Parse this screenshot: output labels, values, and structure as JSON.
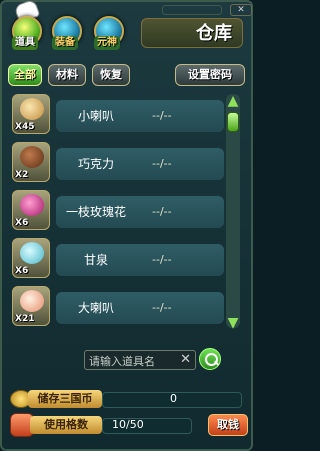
{
  "window": {
    "title": "仓库",
    "close_label": "✕"
  },
  "categories": [
    {
      "label": "道具",
      "icon": "hand-pointer-icon"
    },
    {
      "label": "装备",
      "icon": "orb-icon"
    },
    {
      "label": "元神",
      "icon": "orb-icon"
    }
  ],
  "tabs": [
    "全部",
    "材料",
    "恢复"
  ],
  "set_password": "设置密码",
  "items": [
    {
      "name": "小喇叭",
      "qty": "X45",
      "time": "--/--",
      "icon": "bread-icon"
    },
    {
      "name": "巧克力",
      "qty": "X2",
      "time": "--/--",
      "icon": "chocolate-icon"
    },
    {
      "name": "一枝玫瑰花",
      "qty": "X6",
      "time": "--/--",
      "icon": "rose-icon"
    },
    {
      "name": "甘泉",
      "qty": "X6",
      "time": "--/--",
      "icon": "spring-icon"
    },
    {
      "name": "大喇叭",
      "qty": "X21",
      "time": "--/--",
      "icon": "egg-icon"
    }
  ],
  "search": {
    "placeholder": "请输入道具名",
    "clear": "✕"
  },
  "bottom": {
    "coins_label": "储存三国币",
    "coins_value": "0",
    "slots_label": "使用格数",
    "slots_value": "10/50",
    "withdraw_label": "取钱"
  },
  "colors": {
    "accent": "#3e7c1e",
    "panel": "#173338",
    "plate": "#2f5d66"
  }
}
